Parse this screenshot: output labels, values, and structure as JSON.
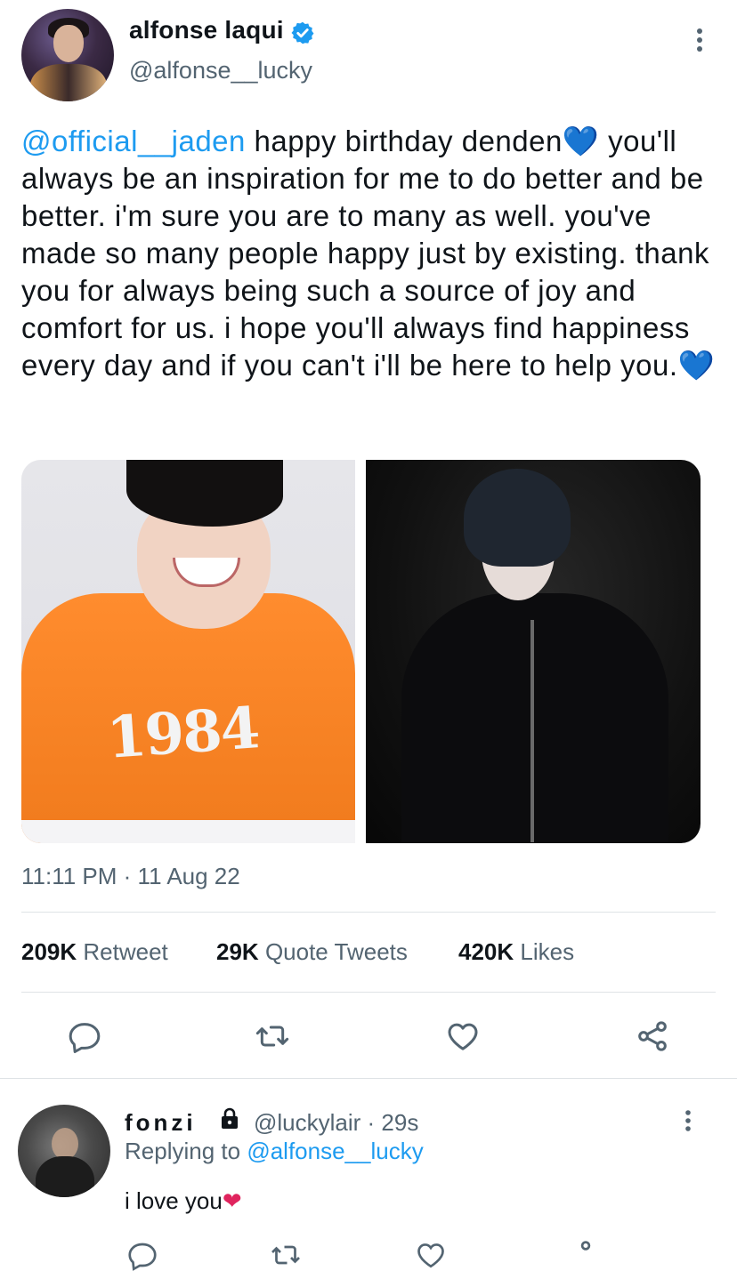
{
  "author": {
    "display_name": "alfonse laqui",
    "handle": "@alfonse__lucky"
  },
  "tweet": {
    "mention": "@official__jaden",
    "text": " happy birthday denden",
    "text_rest": "you'll always be an inspiration for me to do better and be better. i'm sure you are to many as well. you've made so many people happy just by existing. thank you for always being such a source of joy and comfort for us. i hope you'll always find happiness every day and if you can't i'll be here to help you.",
    "emoji": "💙",
    "timestamp": "11:11 PM · 11 Aug 22",
    "photo_left_text": "1984"
  },
  "stats": {
    "retweets_count": "209K",
    "retweets_label": "Retweet",
    "quotes_count": "29K",
    "quotes_label": "Quote Tweets",
    "likes_count": "420K",
    "likes_label": "Likes"
  },
  "actions": [
    "reply-icon",
    "retweet-icon",
    "like-icon",
    "share-icon"
  ],
  "reply": {
    "name": "fonzi",
    "meta": "@luckylair · 29s",
    "replying_label": "Replying to ",
    "replying_to": "@alfonse__lucky",
    "text": "i love you",
    "emoji": "❤"
  },
  "colors": {
    "link": "#1d9bf0",
    "secondary_text": "#536471",
    "verified": "#1d9bf0"
  }
}
